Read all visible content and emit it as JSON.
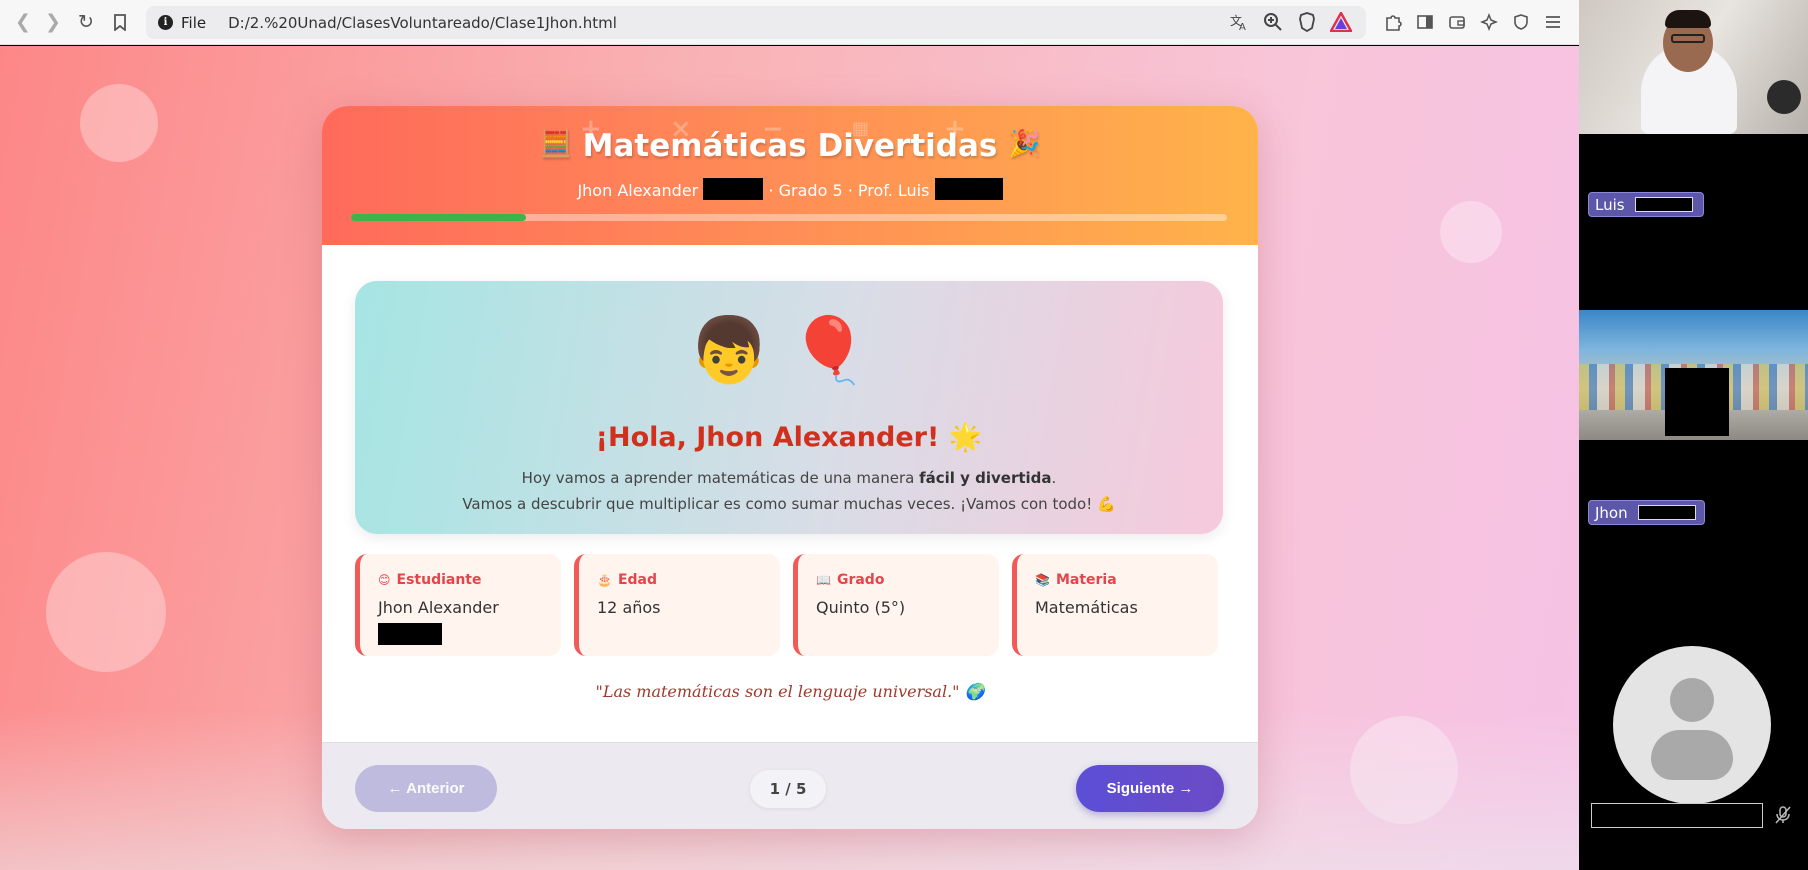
{
  "browser": {
    "scheme_label": "File",
    "url": "D:/2.%20Unad/ClasesVoluntareado/Clase1Jhon.html"
  },
  "lesson": {
    "title": "Matemáticas Divertidas",
    "title_emoji_left": "🧮",
    "title_emoji_right": "🎉",
    "subtitle_student": "Jhon Alexander",
    "subtitle_grade": "· Grado 5 · Prof. Luis",
    "progress_fraction": 0.2,
    "colors": {
      "accent": "#ff8e56",
      "progress": "#3cb44b",
      "label": "#e5454a",
      "next_button": "#5b4fd6"
    },
    "hero": {
      "emojis": "👦🎈",
      "greeting": "¡Hola, Jhon Alexander!",
      "greeting_emoji": "🌟",
      "line1_start": "Hoy vamos a aprender matemáticas de una manera ",
      "line1_bold": "fácil y divertida",
      "line1_end": ".",
      "line2": "Vamos a descubrir que multiplicar es como sumar muchas veces. ¡Vamos con todo! 💪"
    },
    "info_cards": [
      {
        "icon": "😊",
        "label": "Estudiante",
        "value": "Jhon Alexander"
      },
      {
        "icon": "🎂",
        "label": "Edad",
        "value": "12 años"
      },
      {
        "icon": "📖",
        "label": "Grado",
        "value": "Quinto (5°)"
      },
      {
        "icon": "📚",
        "label": "Materia",
        "value": "Matemáticas"
      }
    ],
    "quote": "\"Las matemáticas son el lenguaje universal.\" 🌍",
    "footer": {
      "prev_label": "← Anterior",
      "page_indicator": "1 / 5",
      "next_label": "Siguiente →"
    }
  },
  "call": {
    "participants": [
      {
        "name": "Luis"
      },
      {
        "name": "Jhon"
      }
    ]
  }
}
